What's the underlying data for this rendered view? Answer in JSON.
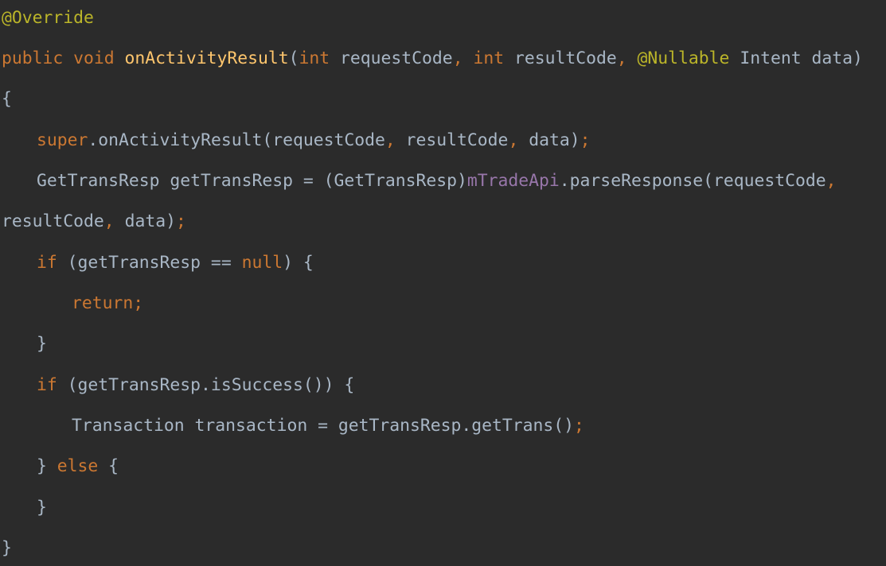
{
  "colors": {
    "background": "#2b2b2b",
    "default_text": "#a9b7c6",
    "keyword": "#cc7832",
    "annotation": "#bbb529",
    "method_declaration": "#ffc66d",
    "field": "#9876aa"
  },
  "code_lines": [
    {
      "indent": 0,
      "tokens": [
        {
          "text": "@Override",
          "kind": "annotation"
        }
      ]
    },
    {
      "indent": 0,
      "tokens": [
        {
          "text": "public void ",
          "kind": "keyword"
        },
        {
          "text": "onActivityResult",
          "kind": "method"
        },
        {
          "text": "(",
          "kind": "plain"
        },
        {
          "text": "int ",
          "kind": "keyword"
        },
        {
          "text": "requestCode",
          "kind": "plain"
        },
        {
          "text": ", ",
          "kind": "punct"
        },
        {
          "text": "int ",
          "kind": "keyword"
        },
        {
          "text": "resultCode",
          "kind": "plain"
        },
        {
          "text": ", ",
          "kind": "punct"
        },
        {
          "text": "@Nullable ",
          "kind": "annotation"
        },
        {
          "text": "Intent data)",
          "kind": "plain"
        }
      ]
    },
    {
      "indent": 0,
      "tokens": [
        {
          "text": "{",
          "kind": "plain"
        }
      ]
    },
    {
      "indent": 1,
      "tokens": [
        {
          "text": "super",
          "kind": "keyword"
        },
        {
          "text": ".onActivityResult(requestCode",
          "kind": "plain"
        },
        {
          "text": ", ",
          "kind": "punct"
        },
        {
          "text": "resultCode",
          "kind": "plain"
        },
        {
          "text": ", ",
          "kind": "punct"
        },
        {
          "text": "data)",
          "kind": "plain"
        },
        {
          "text": ";",
          "kind": "punct"
        }
      ]
    },
    {
      "indent": 1,
      "tokens": [
        {
          "text": "GetTransResp getTransResp = (GetTransResp)",
          "kind": "plain"
        },
        {
          "text": "mTradeApi",
          "kind": "field"
        },
        {
          "text": ".parseResponse(requestCode",
          "kind": "plain"
        },
        {
          "text": ",",
          "kind": "punct"
        }
      ]
    },
    {
      "indent": 0,
      "tokens": [
        {
          "text": "resultCode",
          "kind": "plain"
        },
        {
          "text": ", ",
          "kind": "punct"
        },
        {
          "text": "data)",
          "kind": "plain"
        },
        {
          "text": ";",
          "kind": "punct"
        }
      ]
    },
    {
      "indent": 1,
      "tokens": [
        {
          "text": "if ",
          "kind": "keyword"
        },
        {
          "text": "(getTransResp == ",
          "kind": "plain"
        },
        {
          "text": "null",
          "kind": "keyword"
        },
        {
          "text": ") {",
          "kind": "plain"
        }
      ]
    },
    {
      "indent": 2,
      "tokens": [
        {
          "text": "return;",
          "kind": "keyword"
        }
      ]
    },
    {
      "indent": 1,
      "tokens": [
        {
          "text": "}",
          "kind": "plain"
        }
      ]
    },
    {
      "indent": 1,
      "tokens": [
        {
          "text": "if ",
          "kind": "keyword"
        },
        {
          "text": "(getTransResp.isSuccess()) {",
          "kind": "plain"
        }
      ]
    },
    {
      "indent": 2,
      "tokens": [
        {
          "text": "Transaction transaction = getTransResp.getTrans()",
          "kind": "plain"
        },
        {
          "text": ";",
          "kind": "punct"
        }
      ]
    },
    {
      "indent": 1,
      "tokens": [
        {
          "text": "} ",
          "kind": "plain"
        },
        {
          "text": "else ",
          "kind": "keyword"
        },
        {
          "text": "{",
          "kind": "plain"
        }
      ]
    },
    {
      "indent": 1,
      "tokens": [
        {
          "text": "}",
          "kind": "plain"
        }
      ]
    },
    {
      "indent": 0,
      "tokens": [
        {
          "text": "}",
          "kind": "plain"
        }
      ]
    }
  ]
}
